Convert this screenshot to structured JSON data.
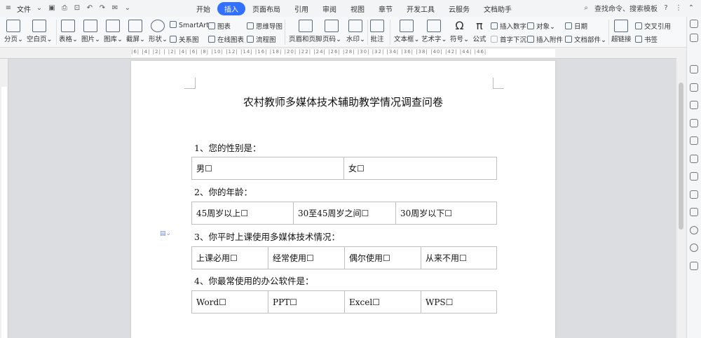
{
  "menubar": {
    "file_label": "文件",
    "tabs": [
      "开始",
      "插入",
      "页面布局",
      "引用",
      "审阅",
      "视图",
      "章节",
      "开发工具",
      "云服务",
      "文档助手"
    ],
    "active_tab": "插入",
    "search_label": "查找命令、搜索模板"
  },
  "ribbon": {
    "page_break": "分页",
    "blank_page": "空白页",
    "table": "表格",
    "picture": "图片",
    "gallery": "图库",
    "screenshot": "截屏",
    "shape": "形状",
    "smartart": "SmartArt",
    "relation_chart": "关系图",
    "chart": "图表",
    "online_chart": "在线图表",
    "mindmap": "思维导图",
    "flowchart": "流程图",
    "header_footer": "页眉和页脚",
    "page_number": "页码",
    "watermark": "水印",
    "comment": "批注",
    "textbox": "文本框",
    "wordart": "艺术字",
    "symbol": "符号",
    "formula": "公式",
    "insert_number": "插入数字",
    "first_letter": "首字下沉",
    "object": "对象",
    "attachment": "插入附件",
    "date": "日期",
    "doc_parts": "文档部件",
    "hyperlink": "超链接",
    "cross_ref": "交叉引用",
    "bookmark": "书签"
  },
  "ruler": {
    "numbers": "|6| |4| |2| | |2| |4| |6| |8| |10| |12| |14| |16| |18| |20| |22| |24| |26| |28| |30| |32| |34| |36| |38| |40| |42| |44| |46|"
  },
  "document": {
    "title": "农村教师多媒体技术辅助教学情况调查问卷",
    "questions": [
      {
        "text": "1、您的性别是：",
        "options": [
          "男☐",
          "女☐"
        ]
      },
      {
        "text": "2、你的年龄：",
        "options": [
          "45周岁以上☐",
          "30至45周岁之间☐",
          "30周岁以下☐"
        ]
      },
      {
        "text": "3、你平时上课使用多媒体技术情况：",
        "options": [
          "上课必用☐",
          "经常使用☐",
          "偶尔使用☐",
          "从来不用☐"
        ]
      },
      {
        "text": "4、你最常使用的办公软件是：",
        "options": [
          "Word☐",
          "PPT☐",
          "Excel☐",
          "WPS☐"
        ]
      }
    ]
  },
  "icons": [
    "menu-icon",
    "save-icon",
    "print-icon",
    "undo-icon",
    "redo-icon",
    "search-icon",
    "help-icon",
    "more-icon",
    "pen-icon",
    "cursor-icon",
    "shapes-icon",
    "settings-icon",
    "lock-icon",
    "copy-icon",
    "star-icon",
    "share-icon",
    "archive-icon",
    "history-icon",
    "question-icon",
    "apps-icon"
  ],
  "colors": {
    "accent": "#3370ff"
  }
}
